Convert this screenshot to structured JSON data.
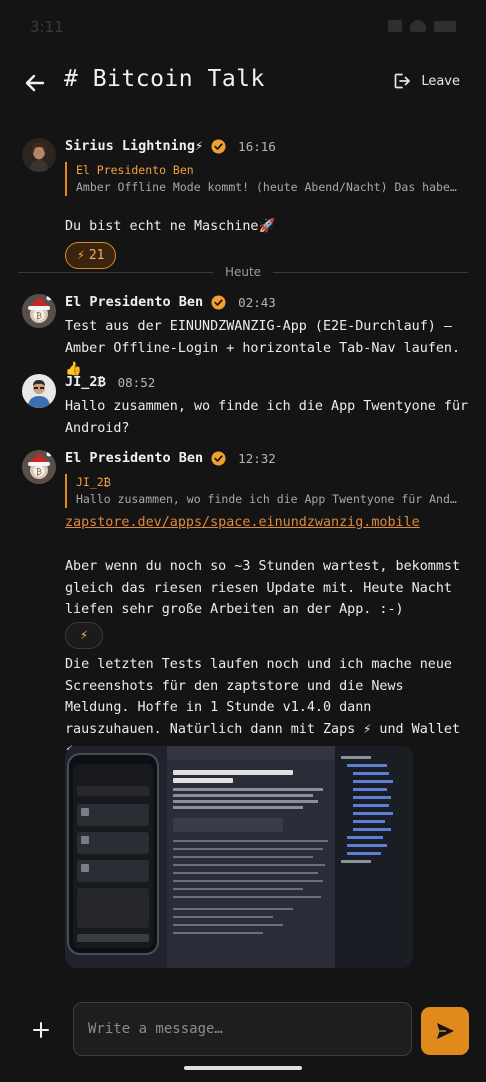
{
  "status_bar": {
    "time": "3:11"
  },
  "header": {
    "title": "# Bitcoin Talk",
    "leave_label": "Leave"
  },
  "messages": [
    {
      "author": "Sirius Lightning⚡",
      "time": "16:16",
      "reply": {
        "author": "El Presidento Ben",
        "text": "Amber Offline Mode kommt! (heute Abend/Nacht) Das haben no…"
      },
      "text": "Du bist echt ne Maschine🚀",
      "reaction": {
        "emoji": "⚡",
        "count": "21"
      }
    },
    {
      "author": "El Presidento Ben",
      "time": "02:43",
      "text": "Test aus der EINUNDZWANZIG-App (E2E-Durchlauf) — Amber Offline-Login + horizontale Tab-Nav laufen. 👍"
    },
    {
      "author": "JI_2₿",
      "time": "08:52",
      "text": "Hallo zusammen, wo finde ich die App Twentyone für Android?"
    },
    {
      "author": "El Presidento Ben",
      "time": "12:32",
      "reply": {
        "author": "JI_2₿",
        "text": "Hallo zusammen, wo finde ich die App Twentyone für Android?"
      },
      "link": "zapstore.dev/apps/space.einundzwanzig.mobile",
      "text2": "Aber wenn du noch so ~3 Stunden wartest, bekommst gleich das riesen riesen Update mit. Heute Nacht liefen sehr große Arbeiten an der App. :-)",
      "reaction": {
        "emoji": "⚡"
      },
      "text3": "Die letzten Tests laufen noch und ich mache neue Screenshots für den zaptstore und die News Meldung. Hoffe in 1 Stunde v1.4.0 dann rauszuhauen. Natürlich dann mit Zaps ⚡ und Wallet ⚡",
      "attachment": {
        "app_name": "EINUNDZWANZIG",
        "report_title": "E2E-Emulator-Report — EINUNDZWANZIG Mobile-App (English-Lauf)"
      }
    }
  ],
  "day_divider": "Heute",
  "composer": {
    "placeholder": "Write a message…"
  },
  "colors": {
    "accent": "#e08a1e",
    "background": "#141414",
    "verified": "#f0a030"
  }
}
